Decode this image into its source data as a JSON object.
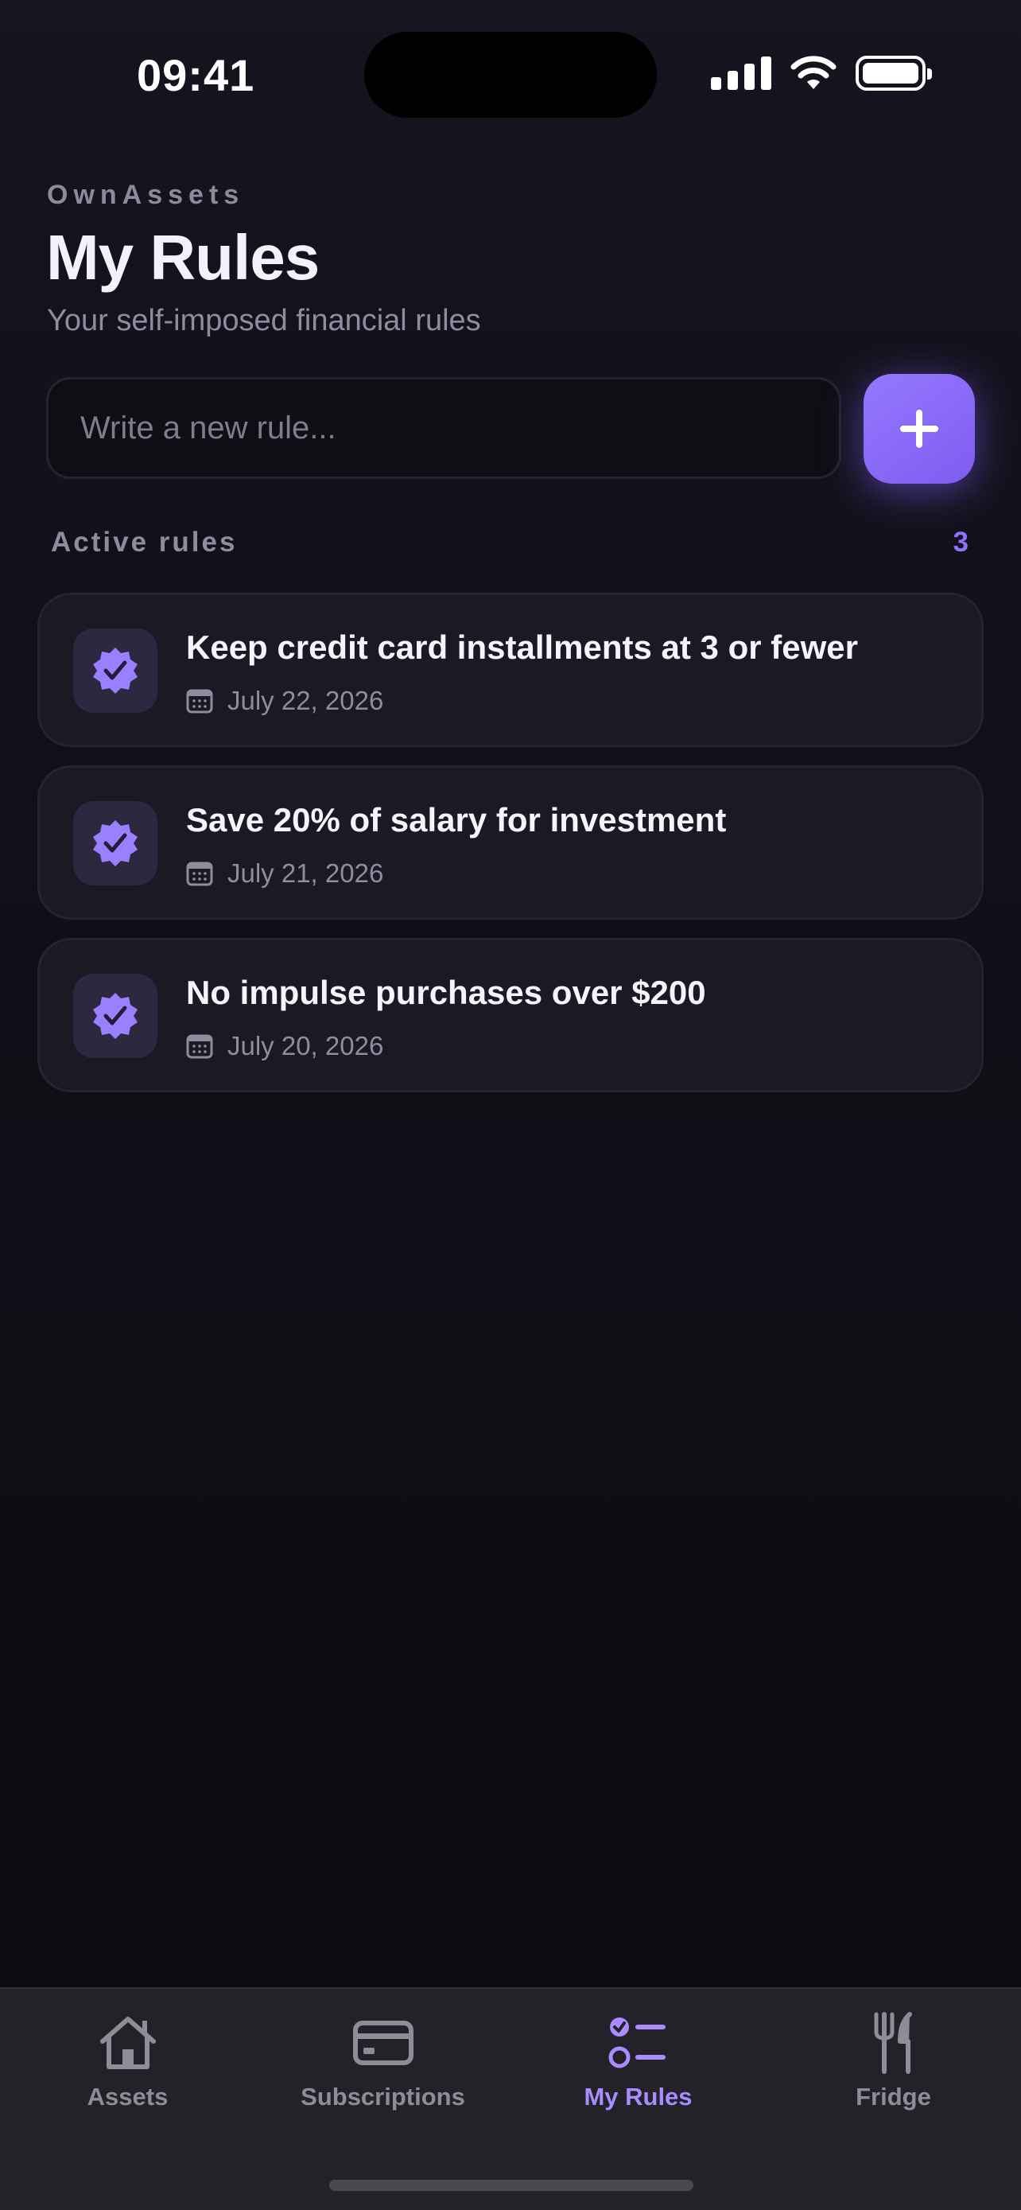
{
  "status_bar": {
    "time": "09:41"
  },
  "header": {
    "brand": "OwnAssets",
    "title": "My Rules",
    "subtitle": "Your self-imposed financial rules"
  },
  "new_rule": {
    "placeholder": "Write a new rule...",
    "value": ""
  },
  "section": {
    "label": "Active rules",
    "count": "3"
  },
  "rules": [
    {
      "title": "Keep credit card installments at 3 or fewer",
      "date": "July 22, 2026"
    },
    {
      "title": "Save 20% of salary for investment",
      "date": "July 21, 2026"
    },
    {
      "title": "No impulse purchases over $200",
      "date": "July 20, 2026"
    }
  ],
  "tabs": [
    {
      "label": "Assets",
      "icon": "house-icon"
    },
    {
      "label": "Subscriptions",
      "icon": "card-icon"
    },
    {
      "label": "My Rules",
      "icon": "checklist-icon",
      "active": true
    },
    {
      "label": "Fridge",
      "icon": "fork-knife-icon"
    }
  ],
  "colors": {
    "accent": "#8f72ff",
    "background": "#100f17",
    "card": "#1b1a24"
  }
}
